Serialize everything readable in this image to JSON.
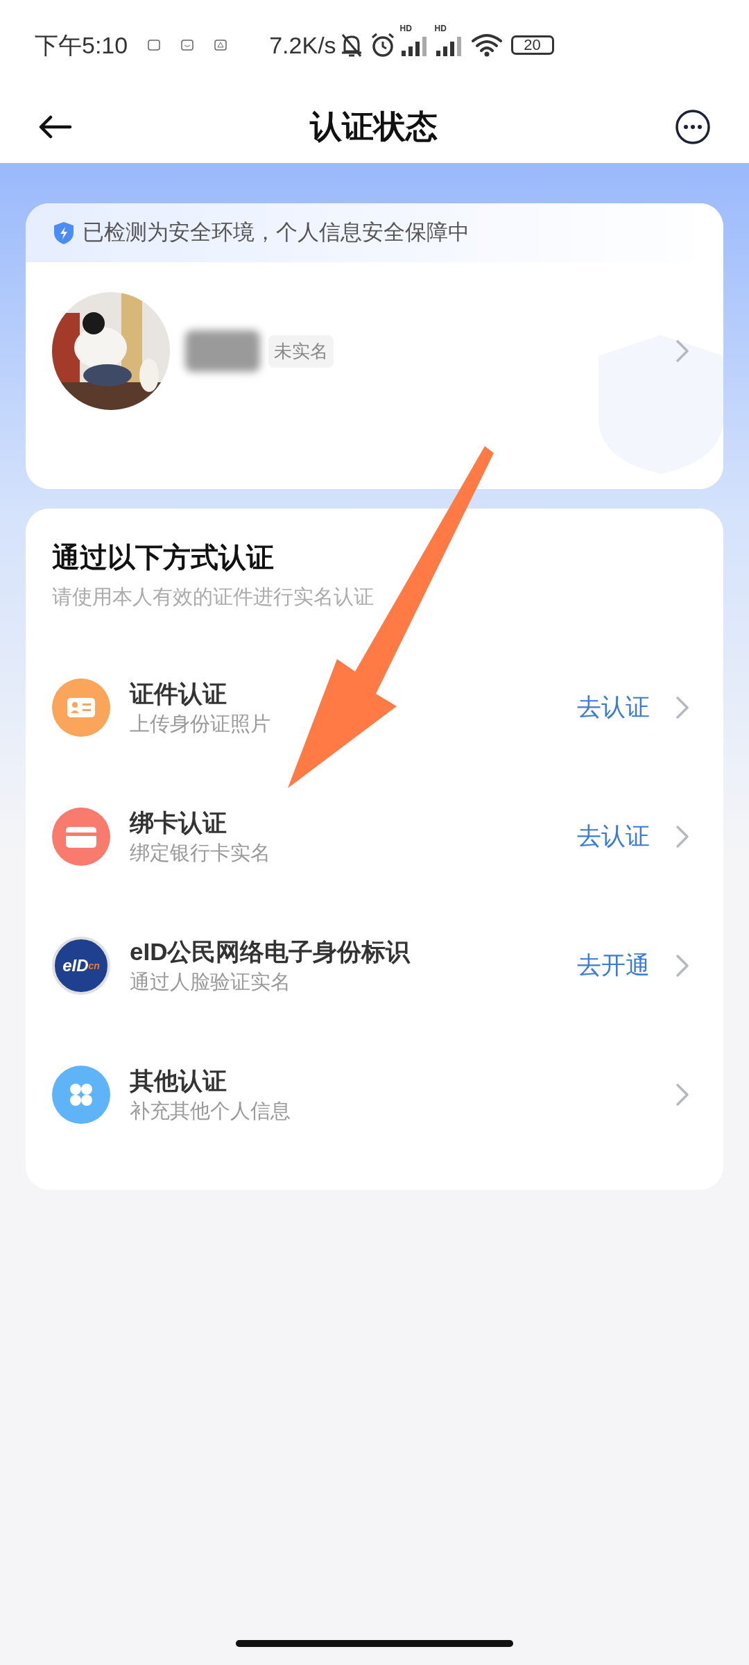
{
  "status_bar": {
    "time": "下午5:10",
    "speed": "7.2K/s",
    "signal_labels": [
      "HD",
      "HD"
    ],
    "battery": "20"
  },
  "header": {
    "title": "认证状态"
  },
  "profile_card": {
    "security_notice": "已检测为安全环境，个人信息安全保障中",
    "status_tag": "未实名"
  },
  "methods": {
    "title": "通过以下方式认证",
    "subtitle": "请使用本人有效的证件进行实名认证",
    "items": [
      {
        "kind": "id-card",
        "title": "证件认证",
        "subtitle": "上传身份证照片",
        "action": "去认证"
      },
      {
        "kind": "bank-card",
        "title": "绑卡认证",
        "subtitle": "绑定银行卡实名",
        "action": "去认证"
      },
      {
        "kind": "eid",
        "title": "eID公民网络电子身份标识",
        "subtitle": "通过人脸验证实名",
        "action": "去开通",
        "logo": "eID",
        "logo_suffix": "cn"
      },
      {
        "kind": "other",
        "title": "其他认证",
        "subtitle": "补充其他个人信息"
      }
    ]
  }
}
